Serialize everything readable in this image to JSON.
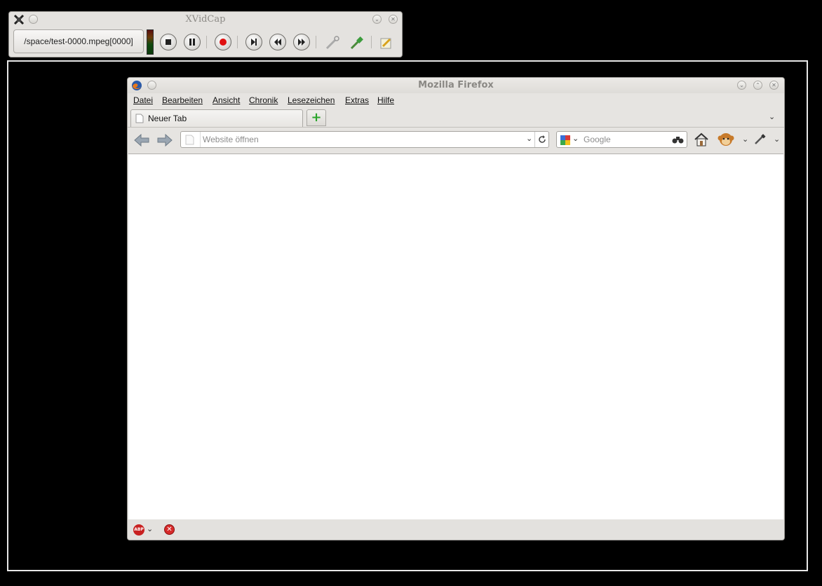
{
  "xvidcap": {
    "title": "XVidCap",
    "filename": "/space/test-0000.mpeg[0000]",
    "buttons": [
      "stop",
      "pause",
      "record",
      "step",
      "rewind",
      "forward",
      "select-region",
      "eyedropper",
      "edit"
    ]
  },
  "firefox": {
    "title": "Mozilla Firefox",
    "menu": [
      "Datei",
      "Bearbeiten",
      "Ansicht",
      "Chronik",
      "Lesezeichen",
      "Extras",
      "Hilfe"
    ],
    "tab_label": "Neuer Tab",
    "url_placeholder": "Website öffnen",
    "search_placeholder": "Google",
    "abp_label": "ABP"
  },
  "colors": {
    "desktop": "#000000",
    "frame_border": "#e8e8e8",
    "window_bg": "#e6e4e1"
  }
}
